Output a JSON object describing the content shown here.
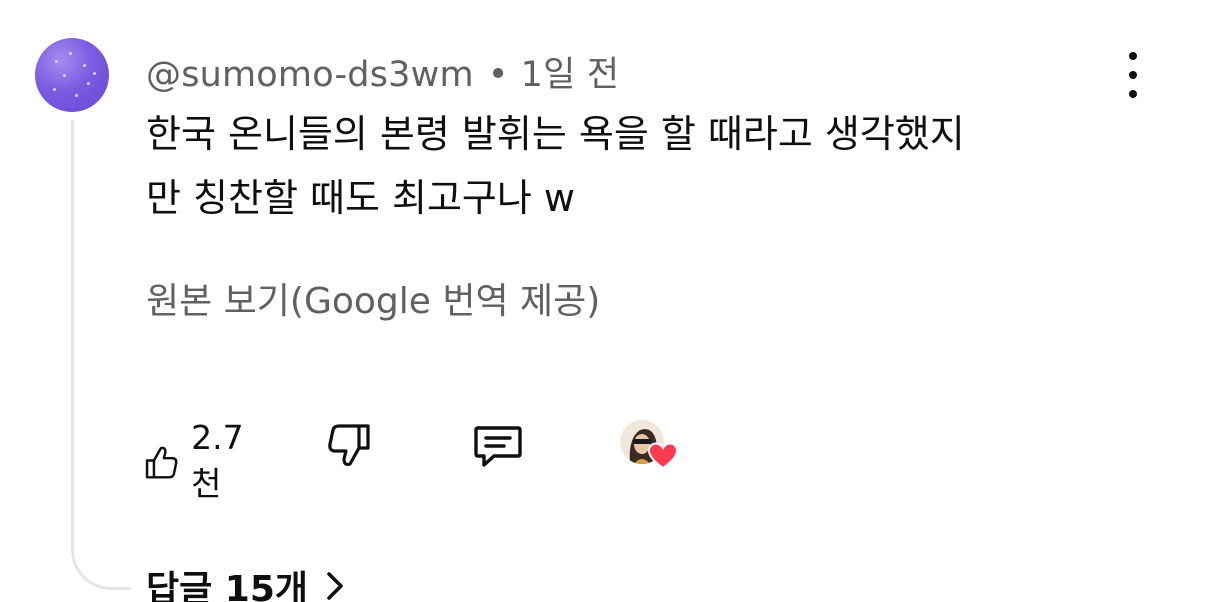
{
  "comment": {
    "author": "@sumomo-ds3wm",
    "separator": "•",
    "time": "1일 전",
    "text_line1": "한국 온니들의 본령 발휘는 욕을 할 때라고 생각했지",
    "text_line2": "만 칭찬할 때도 최고구나 w",
    "translate_link": "원본 보기(Google 번역 제공)",
    "like_count": "2.7천",
    "replies_label": "답글 15개"
  },
  "icons": {
    "menu": "more-vertical-icon",
    "like": "thumbs-up-icon",
    "dislike": "thumbs-down-icon",
    "reply": "comment-icon",
    "heart": "heart-icon",
    "chevron": "chevron-right-icon"
  },
  "colors": {
    "avatar": "#7a5ce0",
    "heart": "#ff3b4f",
    "secondary_text": "#606060",
    "thread_line": "#e5e5e5"
  }
}
